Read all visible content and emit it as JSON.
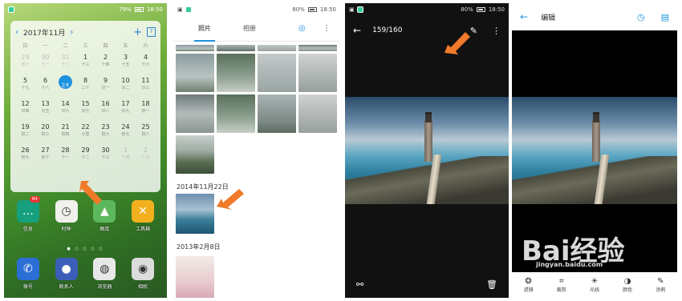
{
  "home": {
    "status": {
      "battery": "79%",
      "time": "18:50"
    },
    "calendar": {
      "month_label": "2017年11月",
      "prev": "‹",
      "next": "›",
      "weekdays": [
        "日",
        "一",
        "二",
        "三",
        "四",
        "五",
        "六"
      ],
      "weeks": [
        [
          [
            "29",
            "初十",
            1
          ],
          [
            "30",
            "十一",
            1
          ],
          [
            "31",
            "十二",
            1
          ],
          [
            "1",
            "十三",
            0
          ],
          [
            "2",
            "十四",
            0
          ],
          [
            "3",
            "十五",
            0
          ],
          [
            "4",
            "十六",
            0
          ]
        ],
        [
          [
            "5",
            "十七",
            0
          ],
          [
            "6",
            "十八",
            0
          ],
          [
            "7",
            "立冬",
            2
          ],
          [
            "8",
            "二十",
            0
          ],
          [
            "9",
            "廿一",
            0
          ],
          [
            "10",
            "廿二",
            0
          ],
          [
            "11",
            "廿三",
            0
          ]
        ],
        [
          [
            "12",
            "廿四",
            0
          ],
          [
            "13",
            "廿五",
            0
          ],
          [
            "14",
            "廿六",
            0
          ],
          [
            "15",
            "廿七",
            0
          ],
          [
            "16",
            "廿八",
            0
          ],
          [
            "17",
            "廿九",
            0
          ],
          [
            "18",
            "初一",
            0
          ]
        ],
        [
          [
            "19",
            "初二",
            0
          ],
          [
            "20",
            "初三",
            0
          ],
          [
            "21",
            "初四",
            0
          ],
          [
            "22",
            "小雪",
            0
          ],
          [
            "23",
            "初六",
            0
          ],
          [
            "24",
            "初七",
            0
          ],
          [
            "25",
            "初八",
            0
          ]
        ],
        [
          [
            "26",
            "初九",
            0
          ],
          [
            "27",
            "初十",
            0
          ],
          [
            "28",
            "十一",
            0
          ],
          [
            "29",
            "十二",
            0
          ],
          [
            "30",
            "十三",
            0
          ],
          [
            "1",
            "十四",
            1
          ],
          [
            "2",
            "十五",
            1
          ]
        ]
      ]
    },
    "apps_row1": [
      {
        "label": "信息",
        "badge": "64",
        "color": "#17a07d",
        "icon": "message-icon",
        "glyph": "…"
      },
      {
        "label": "时钟",
        "badge": "",
        "color": "#f0f0ec",
        "icon": "clock-icon",
        "glyph": "◷"
      },
      {
        "label": "图库",
        "badge": "",
        "color": "#5cb85c",
        "icon": "gallery-icon",
        "glyph": "▲"
      },
      {
        "label": "工具箱",
        "badge": "",
        "color": "#f2b01e",
        "icon": "toolbox-icon",
        "glyph": "✕"
      }
    ],
    "apps_row2": [
      {
        "label": "拨号",
        "color": "#2b6fd6",
        "icon": "phone-icon",
        "glyph": "✆"
      },
      {
        "label": "联系人",
        "color": "#3b5fb8",
        "icon": "contacts-icon",
        "glyph": "●"
      },
      {
        "label": "浏览器",
        "color": "#e8e8e8",
        "icon": "browser-icon",
        "glyph": "◍"
      },
      {
        "label": "相机",
        "color": "#dcdcdc",
        "icon": "camera-icon",
        "glyph": "◉"
      }
    ]
  },
  "gallery": {
    "status": {
      "battery": "80%",
      "time": "18:50"
    },
    "tabs": [
      "照片",
      "相册"
    ],
    "date1": "2014年11月22日",
    "date2": "2013年2月8日"
  },
  "viewer": {
    "status": {
      "battery": "80%",
      "time": "18:50"
    },
    "counter": "159/160"
  },
  "editor": {
    "title": "编辑",
    "tools": [
      {
        "label": "滤镜",
        "icon": "filter-icon",
        "glyph": "❂"
      },
      {
        "label": "裁剪",
        "icon": "crop-icon",
        "glyph": "⌗"
      },
      {
        "label": "光线",
        "icon": "light-icon",
        "glyph": "☀"
      },
      {
        "label": "颜色",
        "icon": "color-icon",
        "glyph": "◑"
      },
      {
        "label": "涂鸦",
        "icon": "brush-icon",
        "glyph": "✎"
      }
    ],
    "watermark": "Bai经验",
    "watermark_url": "jingyan.baidu.com"
  },
  "colors": {
    "accent": "#1e90e0",
    "arrow": "#f07a2a"
  }
}
